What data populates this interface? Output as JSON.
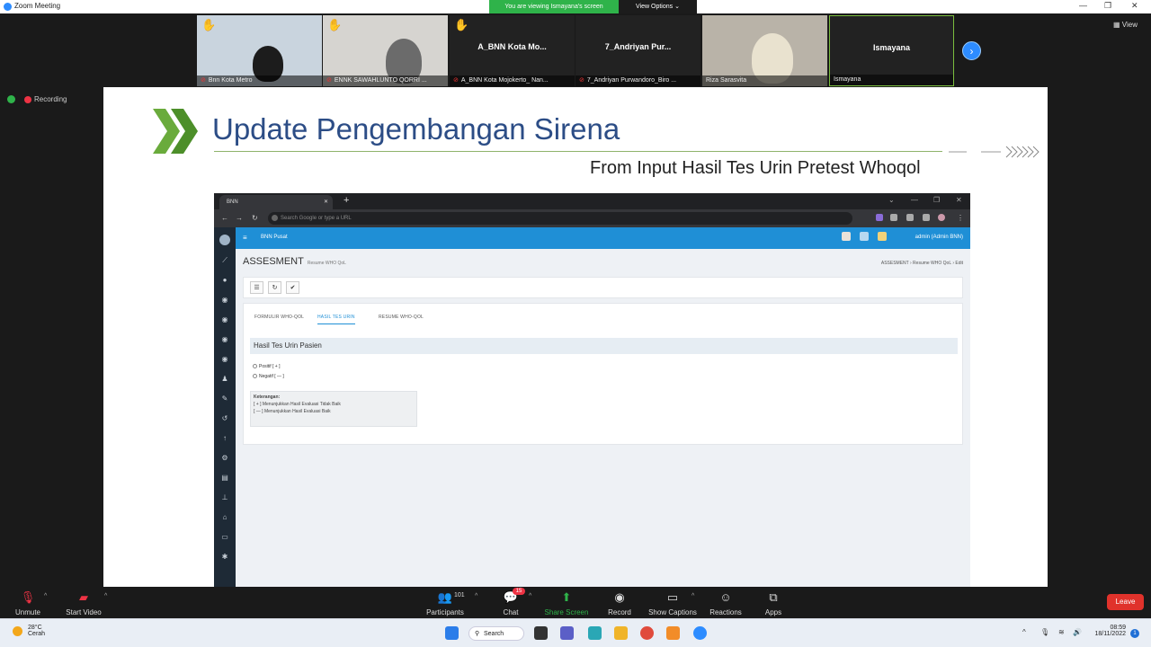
{
  "window": {
    "title": "Zoom Meeting",
    "banner": "You are viewing Ismayana's screen",
    "view_options": "View Options ⌄",
    "view_btn": "View"
  },
  "participants": [
    {
      "name": "Bnn Kota Metro",
      "big": ""
    },
    {
      "name": "ENNK SAWAHLUNTO QORRI ...",
      "big": ""
    },
    {
      "name": "A_BNN Kota Mojokerto_ Nan...",
      "big": "A_BNN Kota Mo..."
    },
    {
      "name": "7_Andriyan Purwandoro_Biro ...",
      "big": "7_Andriyan Pur..."
    },
    {
      "name": "Riza Sarasvita",
      "big": ""
    },
    {
      "name": "Ismayana",
      "big": "Ismayana"
    }
  ],
  "recording": "Recording",
  "slide": {
    "title": "Update Pengembangan Sirena",
    "subtitle": "From Input Hasil Tes Urin Pretest Whoqol"
  },
  "browser": {
    "tab_label": "BNN",
    "omnibox_placeholder": "Search Google or type a URL",
    "app_brand": "BNN Pusat",
    "user_label": "admin (Admin BNN)",
    "page_title": "ASSESMENT",
    "page_subtitle": "Resume WHO QoL",
    "breadcrumbs": "ASSESMENT  ›  Resume WHO QoL  ›  Edit",
    "tabs": [
      "FORMULIR WHO-QOL",
      "HASIL TES URIN",
      "RESUME WHO-QOL"
    ],
    "section_title": "Hasil Tes Urin Pasien",
    "options": [
      "Positif  [ + ]",
      "Negatif  [ — ]"
    ],
    "legend_title": "Keterangan:",
    "legend_items": [
      "[ + ] Menunjukkan Hasil Evaluasi Tidak Baik",
      "[ — ] Menunjukkan Hasil Evaluasi Baik"
    ]
  },
  "zoombar": {
    "unmute": "Unmute",
    "start_video": "Start Video",
    "participants": "Participants",
    "participants_count": "101",
    "chat": "Chat",
    "chat_badge": "15",
    "share": "Share Screen",
    "record": "Record",
    "captions": "Show Captions",
    "reactions": "Reactions",
    "apps": "Apps",
    "leave": "Leave"
  },
  "taskbar": {
    "temp": "28°C",
    "weather": "Cerah",
    "search": "Search",
    "time": "08:59",
    "date": "18/11/2022"
  }
}
